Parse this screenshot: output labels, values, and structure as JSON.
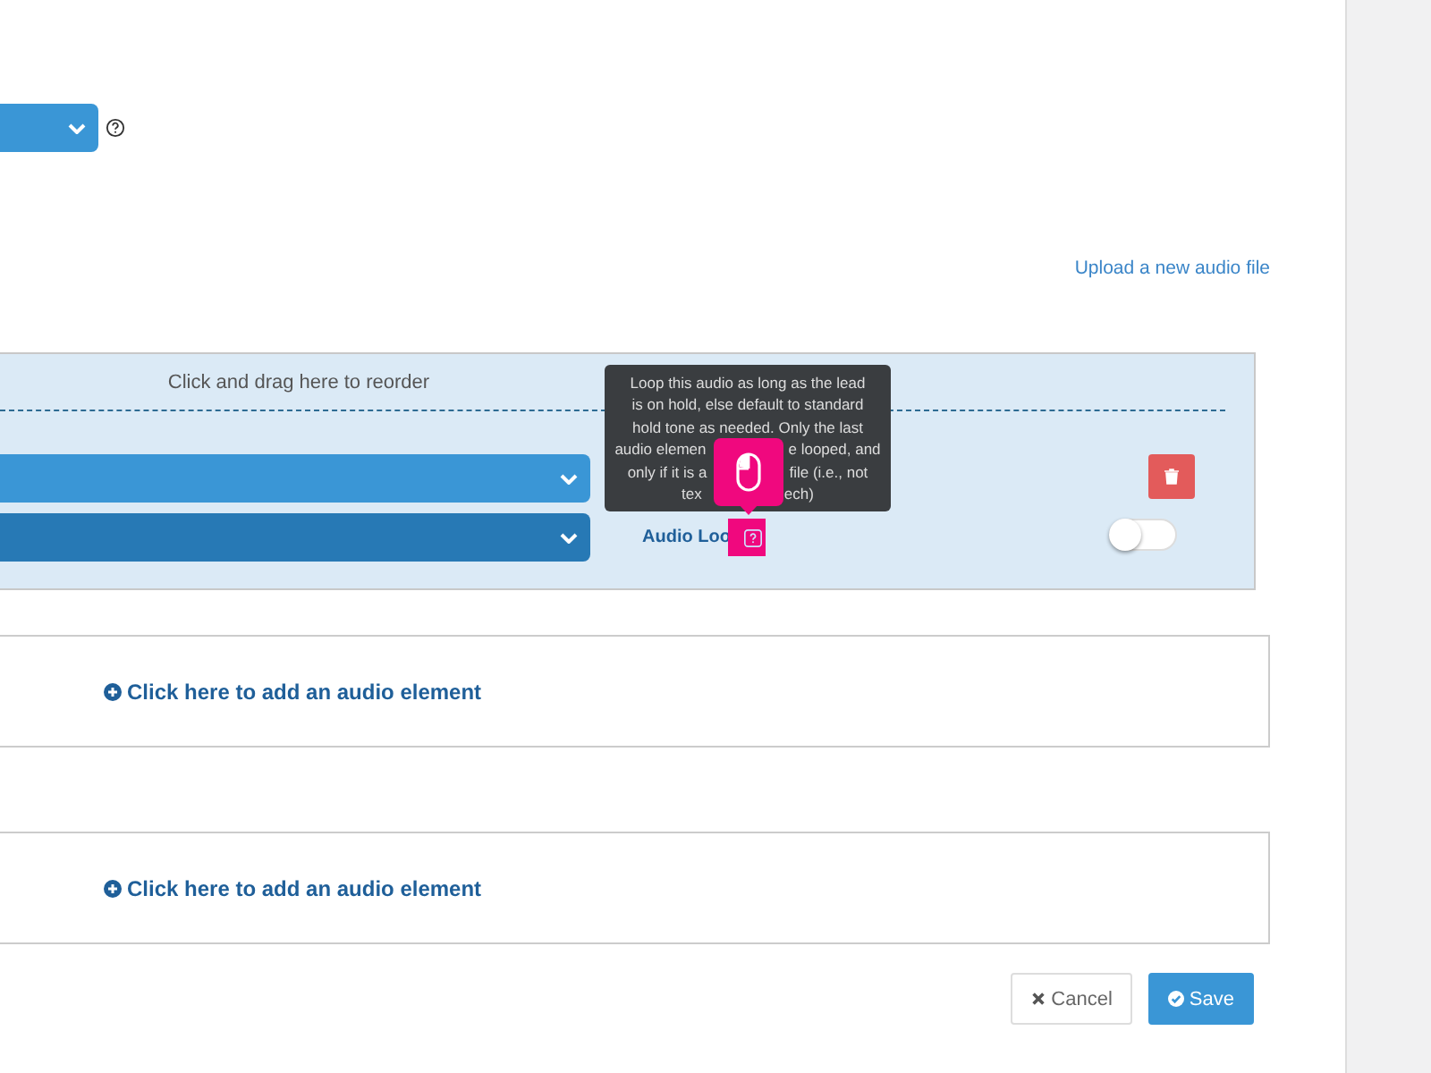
{
  "upload_link": "Upload a new audio file",
  "audio_group": {
    "drag_hint": "Click and drag here to reorder",
    "selects": [
      {
        "focused": false
      },
      {
        "focused": true
      }
    ],
    "loop_label": "Audio Loo",
    "loop_on": false,
    "tooltip": [
      [
        "Loop this audio as long as the lead"
      ],
      [
        "is on hold, else default to standard"
      ],
      [
        "hold tone as needed. Only the last"
      ],
      [
        "audio elemen",
        "e looped, and"
      ],
      [
        "only if it is a",
        "file (i.e., not"
      ],
      [
        "tex",
        "ech)"
      ]
    ]
  },
  "add_elements": [
    "Click here to add an audio element",
    "Click here to add an audio element"
  ],
  "buttons": [
    {
      "kind": "cancel",
      "label": "Cancel"
    },
    {
      "kind": "save",
      "label": "Save"
    }
  ]
}
